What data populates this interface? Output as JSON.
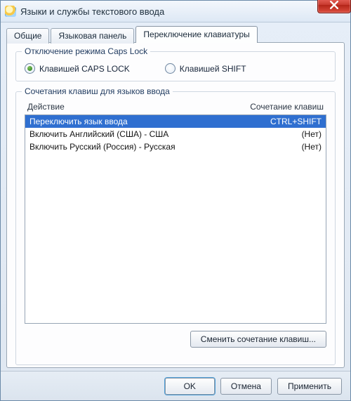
{
  "window": {
    "title": "Языки и службы текстового ввода"
  },
  "tabs": [
    {
      "label": "Общие"
    },
    {
      "label": "Языковая панель"
    },
    {
      "label": "Переключение клавиатуры"
    }
  ],
  "capslock_group": {
    "legend": "Отключение режима Caps Lock",
    "options": [
      {
        "label": "Клавишей CAPS LOCK",
        "selected": true
      },
      {
        "label": "Клавишей SHIFT",
        "selected": false
      }
    ]
  },
  "hotkeys_group": {
    "legend": "Сочетания клавиш для языков ввода",
    "header_action": "Действие",
    "header_combo": "Сочетание клавиш",
    "rows": [
      {
        "action": "Переключить язык ввода",
        "combo": "CTRL+SHIFT",
        "selected": true
      },
      {
        "action": "Включить Английский (США) - США",
        "combo": "(Нет)",
        "selected": false
      },
      {
        "action": "Включить Русский (Россия) - Русская",
        "combo": "(Нет)",
        "selected": false
      }
    ],
    "change_button": "Сменить сочетание клавиш..."
  },
  "footer": {
    "ok": "OK",
    "cancel": "Отмена",
    "apply": "Применить"
  }
}
